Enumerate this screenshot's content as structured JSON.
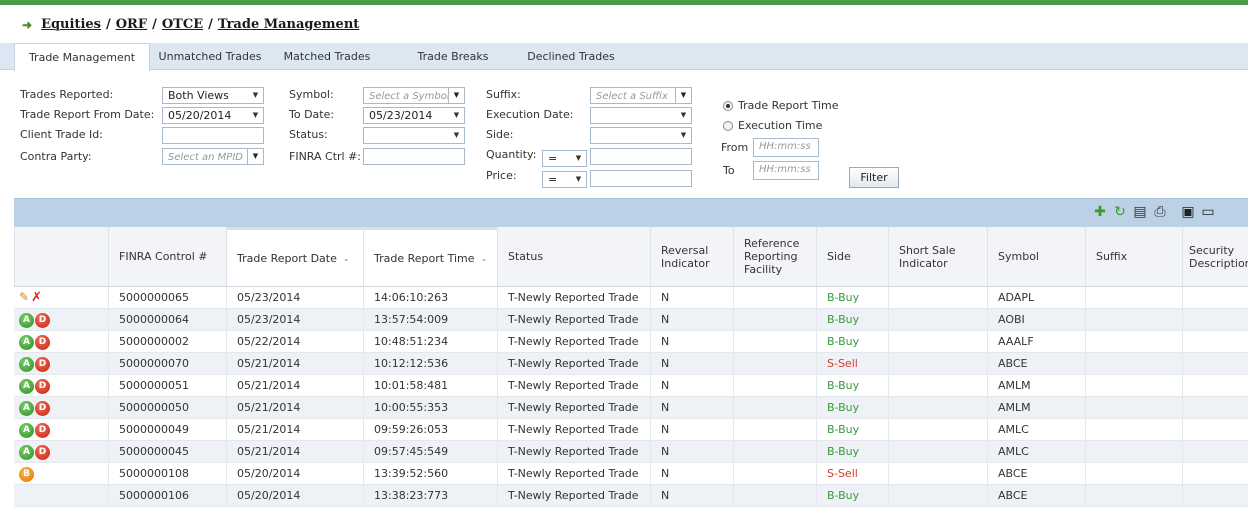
{
  "breadcrumb": {
    "items": [
      "Equities",
      "ORF",
      "OTCE",
      "Trade Management"
    ],
    "separator": "/"
  },
  "tabs": [
    "Trade Management",
    "Unmatched Trades",
    "Matched Trades",
    "Trade Breaks",
    "Declined Trades"
  ],
  "active_tab": "Trade Management",
  "filters": {
    "trades_reported": {
      "label": "Trades Reported:",
      "value": "Both Views"
    },
    "from_date": {
      "label": "Trade Report From Date:",
      "value": "05/20/2014"
    },
    "client_trade_id": {
      "label": "Client Trade Id:",
      "value": ""
    },
    "contra_party": {
      "label": "Contra Party:",
      "placeholder": "Select an MPID"
    },
    "symbol": {
      "label": "Symbol:",
      "placeholder": "Select a Symbol"
    },
    "to_date": {
      "label": "To Date:",
      "value": "05/23/2014"
    },
    "status": {
      "label": "Status:",
      "value": ""
    },
    "finra_ctrl": {
      "label": "FINRA Ctrl #:",
      "value": ""
    },
    "suffix": {
      "label": "Suffix:",
      "placeholder": "Select a Suffix"
    },
    "execution_date": {
      "label": "Execution Date:",
      "value": ""
    },
    "side": {
      "label": "Side:",
      "value": ""
    },
    "quantity": {
      "label": "Quantity:",
      "operator": "="
    },
    "price": {
      "label": "Price:",
      "operator": "="
    },
    "time_mode": {
      "options": [
        "Trade Report Time",
        "Execution Time"
      ],
      "selected": "Trade Report Time"
    },
    "from_time": {
      "label": "From",
      "placeholder": "HH:mm:ss"
    },
    "to_time": {
      "label": "To",
      "placeholder": "HH:mm:ss"
    },
    "filter_button": "Filter"
  },
  "toolbar_icons": [
    "add-icon",
    "refresh-icon",
    "export-csv-icon",
    "print-icon",
    "save-icon",
    "minimize-icon"
  ],
  "columns": [
    "",
    "FINRA Control #",
    "Trade Report Date",
    "Trade Report Time",
    "Status",
    "Reversal Indicator",
    "Reference Reporting Facility",
    "Side",
    "Short Sale Indicator",
    "Symbol",
    "Suffix",
    "Security Description"
  ],
  "rows": [
    {
      "actions": [
        "edit",
        "cancel"
      ],
      "control": "5000000065",
      "date": "05/23/2014",
      "time": "14:06:10:263",
      "status": "T-Newly Reported Trade",
      "reversal": "N",
      "side": "B-Buy",
      "symbol": "ADAPL"
    },
    {
      "actions": [
        "A",
        "D"
      ],
      "control": "5000000064",
      "date": "05/23/2014",
      "time": "13:57:54:009",
      "status": "T-Newly Reported Trade",
      "reversal": "N",
      "side": "B-Buy",
      "symbol": "AOBI"
    },
    {
      "actions": [
        "A",
        "D"
      ],
      "control": "5000000002",
      "date": "05/22/2014",
      "time": "10:48:51:234",
      "status": "T-Newly Reported Trade",
      "reversal": "N",
      "side": "B-Buy",
      "symbol": "AAALF"
    },
    {
      "actions": [
        "A",
        "D"
      ],
      "control": "5000000070",
      "date": "05/21/2014",
      "time": "10:12:12:536",
      "status": "T-Newly Reported Trade",
      "reversal": "N",
      "side": "S-Sell",
      "symbol": "ABCE"
    },
    {
      "actions": [
        "A",
        "D"
      ],
      "control": "5000000051",
      "date": "05/21/2014",
      "time": "10:01:58:481",
      "status": "T-Newly Reported Trade",
      "reversal": "N",
      "side": "B-Buy",
      "symbol": "AMLM"
    },
    {
      "actions": [
        "A",
        "D"
      ],
      "control": "5000000050",
      "date": "05/21/2014",
      "time": "10:00:55:353",
      "status": "T-Newly Reported Trade",
      "reversal": "N",
      "side": "B-Buy",
      "symbol": "AMLM"
    },
    {
      "actions": [
        "A",
        "D"
      ],
      "control": "5000000049",
      "date": "05/21/2014",
      "time": "09:59:26:053",
      "status": "T-Newly Reported Trade",
      "reversal": "N",
      "side": "B-Buy",
      "symbol": "AMLC"
    },
    {
      "actions": [
        "A",
        "D"
      ],
      "control": "5000000045",
      "date": "05/21/2014",
      "time": "09:57:45:549",
      "status": "T-Newly Reported Trade",
      "reversal": "N",
      "side": "B-Buy",
      "symbol": "AMLC"
    },
    {
      "actions": [
        "B"
      ],
      "control": "5000000108",
      "date": "05/20/2014",
      "time": "13:39:52:560",
      "status": "T-Newly Reported Trade",
      "reversal": "N",
      "side": "S-Sell",
      "symbol": "ABCE"
    },
    {
      "actions": [],
      "control": "5000000106",
      "date": "05/20/2014",
      "time": "13:38:23:773",
      "status": "T-Newly Reported Trade",
      "reversal": "N",
      "side": "B-Buy",
      "symbol": "ABCE"
    }
  ]
}
